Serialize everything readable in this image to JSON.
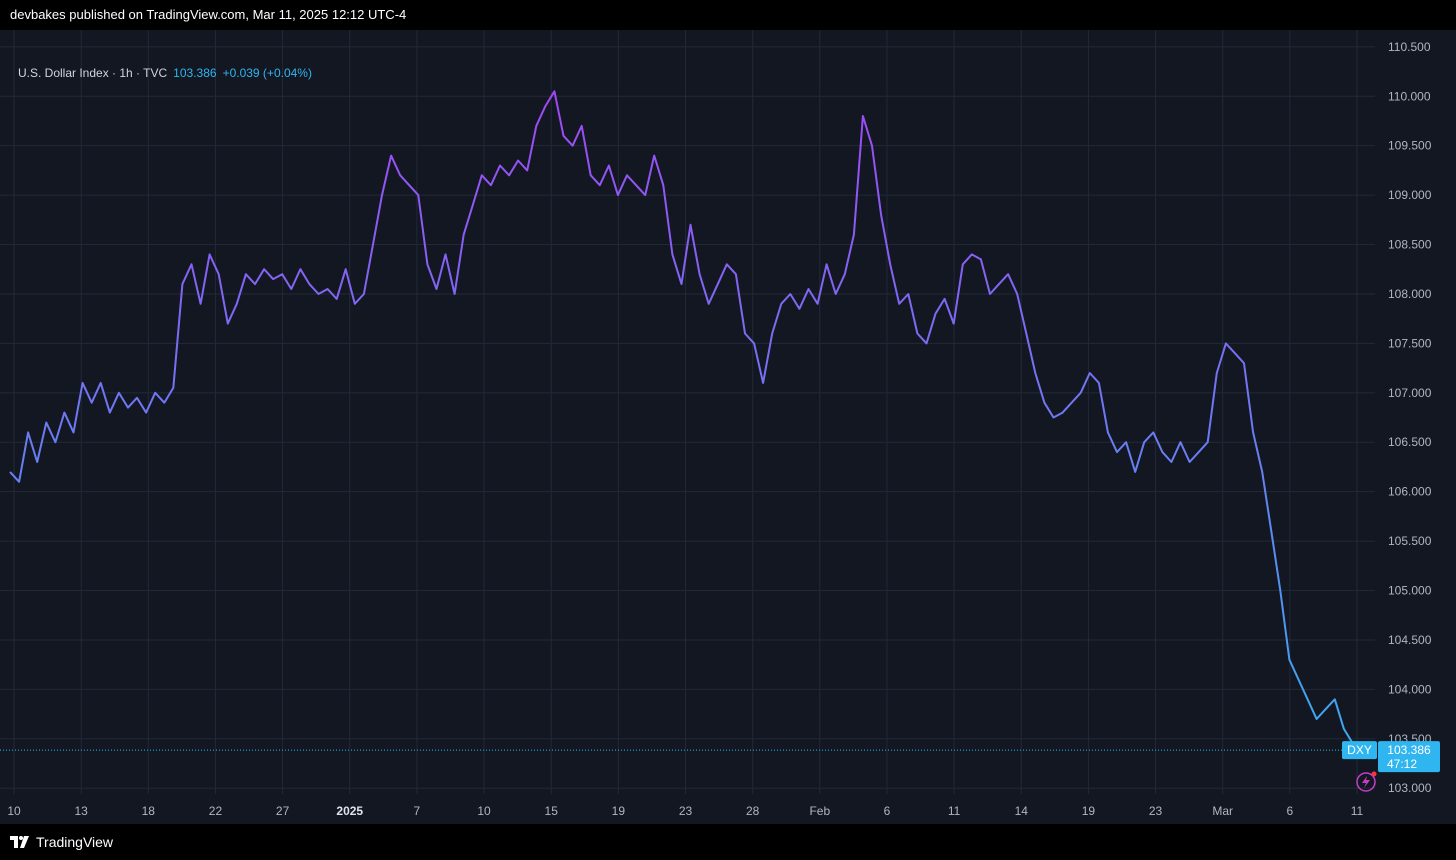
{
  "header": {
    "published": "devbakes published on TradingView.com, Mar 11, 2025 12:12 UTC-4"
  },
  "legend": {
    "symbol_info": "U.S. Dollar Index · 1h · TVC",
    "last": "103.386",
    "change": "+0.039 (+0.04%)"
  },
  "price_tag": {
    "symbol": "DXY",
    "price": "103.386",
    "countdown": "47:12"
  },
  "footer": {
    "brand": "TradingView"
  },
  "icons": {
    "brand_logo": "tradingview-logo-icon",
    "alert": "lightning-alert-icon"
  },
  "colors": {
    "background": "#131722",
    "line_start": "#a93ff5",
    "line_end": "#2fb5f0",
    "grid": "#232838",
    "axis_text": "#b2b5be",
    "price_tag": "#2fb5f0"
  },
  "chart_data": {
    "type": "line",
    "title": "U.S. Dollar Index · 1h · TVC",
    "xlabel": "",
    "ylabel": "",
    "ylim": [
      102.8,
      110.65
    ],
    "y_ticks": [
      "110.500",
      "110.000",
      "109.500",
      "109.000",
      "108.500",
      "108.000",
      "107.500",
      "107.000",
      "106.500",
      "106.000",
      "105.500",
      "105.000",
      "104.500",
      "104.000",
      "103.500",
      "103.000"
    ],
    "x_ticks": [
      {
        "label": "10",
        "bold": false
      },
      {
        "label": "13",
        "bold": false
      },
      {
        "label": "18",
        "bold": false
      },
      {
        "label": "22",
        "bold": false
      },
      {
        "label": "27",
        "bold": false
      },
      {
        "label": "2025",
        "bold": true
      },
      {
        "label": "7",
        "bold": false
      },
      {
        "label": "10",
        "bold": false
      },
      {
        "label": "15",
        "bold": false
      },
      {
        "label": "19",
        "bold": false
      },
      {
        "label": "23",
        "bold": false
      },
      {
        "label": "28",
        "bold": false
      },
      {
        "label": "Feb",
        "bold": false
      },
      {
        "label": "6",
        "bold": false
      },
      {
        "label": "11",
        "bold": false
      },
      {
        "label": "14",
        "bold": false
      },
      {
        "label": "19",
        "bold": false
      },
      {
        "label": "23",
        "bold": false
      },
      {
        "label": "Mar",
        "bold": false
      },
      {
        "label": "6",
        "bold": false
      },
      {
        "label": "11",
        "bold": false
      }
    ],
    "grid": true,
    "current_value": 103.386,
    "series": [
      {
        "values": [
          106.2,
          106.1,
          106.6,
          106.3,
          106.7,
          106.5,
          106.8,
          106.6,
          107.1,
          106.9,
          107.1,
          106.8,
          107.0,
          106.85,
          106.95,
          106.8,
          107.0,
          106.9,
          107.05,
          108.1,
          108.3,
          107.9,
          108.4,
          108.2,
          107.7,
          107.9,
          108.2,
          108.1,
          108.25,
          108.15,
          108.2,
          108.05,
          108.25,
          108.1,
          108.0,
          108.05,
          107.95,
          108.25,
          107.9,
          108.0,
          108.5,
          109.0,
          109.4,
          109.2,
          109.1,
          109.0,
          108.3,
          108.05,
          108.4,
          108.0,
          108.6,
          108.9,
          109.2,
          109.1,
          109.3,
          109.2,
          109.35,
          109.25,
          109.7,
          109.9,
          110.05,
          109.6,
          109.5,
          109.7,
          109.2,
          109.1,
          109.3,
          109.0,
          109.2,
          109.1,
          109.0,
          109.4,
          109.1,
          108.4,
          108.1,
          108.7,
          108.2,
          107.9,
          108.1,
          108.3,
          108.2,
          107.6,
          107.5,
          107.1,
          107.6,
          107.9,
          108.0,
          107.85,
          108.05,
          107.9,
          108.3,
          108.0,
          108.2,
          108.6,
          109.8,
          109.5,
          108.8,
          108.3,
          107.9,
          108.0,
          107.6,
          107.5,
          107.8,
          107.95,
          107.7,
          108.3,
          108.4,
          108.35,
          108.0,
          108.1,
          108.2,
          108.0,
          107.6,
          107.2,
          106.9,
          106.75,
          106.8,
          106.9,
          107.0,
          107.2,
          107.1,
          106.6,
          106.4,
          106.5,
          106.2,
          106.5,
          106.6,
          106.4,
          106.3,
          106.5,
          106.3,
          106.4,
          106.5,
          107.2,
          107.5,
          107.4,
          107.3,
          106.6,
          106.2,
          105.6,
          105.0,
          104.3,
          104.1,
          103.9,
          103.7,
          103.8,
          103.9,
          103.6,
          103.45,
          103.386
        ]
      }
    ]
  }
}
